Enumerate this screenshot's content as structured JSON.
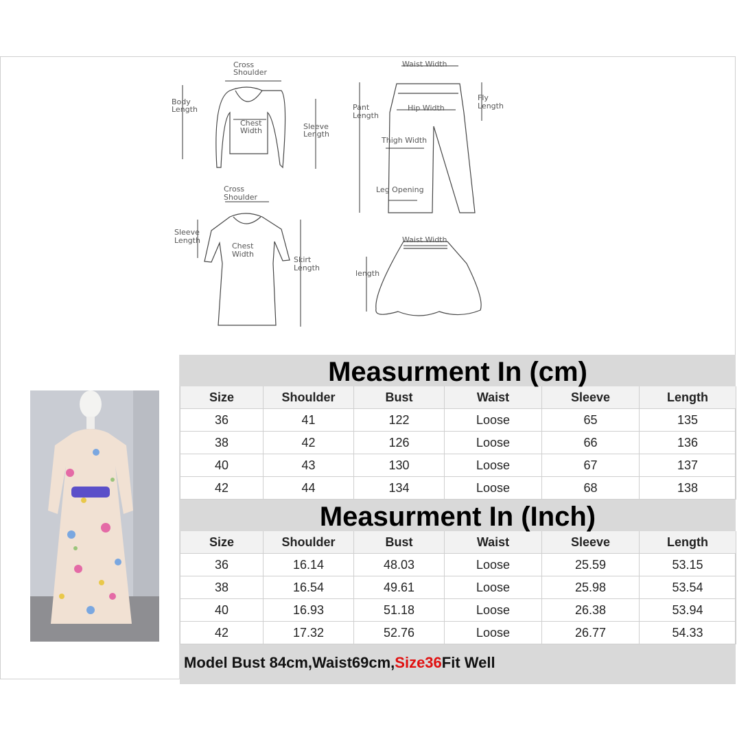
{
  "diagram": {
    "top": {
      "cross_shoulder": "Cross\nShoulder",
      "body_length": "Body\nLength",
      "chest_width": "Chest\nWidth",
      "sleeve_length": "Sleeve\nLength"
    },
    "dress": {
      "cross_shoulder": "Cross\nShoulder",
      "sleeve_length": "Sleeve\nLength",
      "chest_width": "Chest\nWidth",
      "skirt_length": "Skirt\nLength"
    },
    "pants": {
      "waist_width": "Waist Width",
      "pant_length": "Pant\nLength",
      "hip_width": "Hip Width",
      "fly_length": "Fly\nLength",
      "thigh_width": "Thigh Width",
      "leg_opening": "Leg Opening"
    },
    "skirt": {
      "waist_width": "Waist Width",
      "length": "length"
    }
  },
  "cm_table": {
    "title": "Measurment In (cm)",
    "headers": [
      "Size",
      "Shoulder",
      "Bust",
      "Waist",
      "Sleeve",
      "Length"
    ],
    "rows": [
      [
        "36",
        "41",
        "122",
        "Loose",
        "65",
        "135"
      ],
      [
        "38",
        "42",
        "126",
        "Loose",
        "66",
        "136"
      ],
      [
        "40",
        "43",
        "130",
        "Loose",
        "67",
        "137"
      ],
      [
        "42",
        "44",
        "134",
        "Loose",
        "68",
        "138"
      ]
    ]
  },
  "inch_table": {
    "title": "Measurment In (Inch)",
    "headers": [
      "Size",
      "Shoulder",
      "Bust",
      "Waist",
      "Sleeve",
      "Length"
    ],
    "rows": [
      [
        "36",
        "16.14",
        "48.03",
        "Loose",
        "25.59",
        "53.15"
      ],
      [
        "38",
        "16.54",
        "49.61",
        "Loose",
        "25.98",
        "53.54"
      ],
      [
        "40",
        "16.93",
        "51.18",
        "Loose",
        "26.38",
        "53.94"
      ],
      [
        "42",
        "17.32",
        "52.76",
        "Loose",
        "26.77",
        "54.33"
      ]
    ]
  },
  "note": {
    "prefix": "Model Bust 84cm,Waist69cm,",
    "highlight": "Size36",
    "suffix": "Fit Well"
  },
  "colors": {
    "header_gray": "#d9d9d9",
    "highlight_red": "#e01010",
    "belt_purple": "#5b4fc9"
  }
}
